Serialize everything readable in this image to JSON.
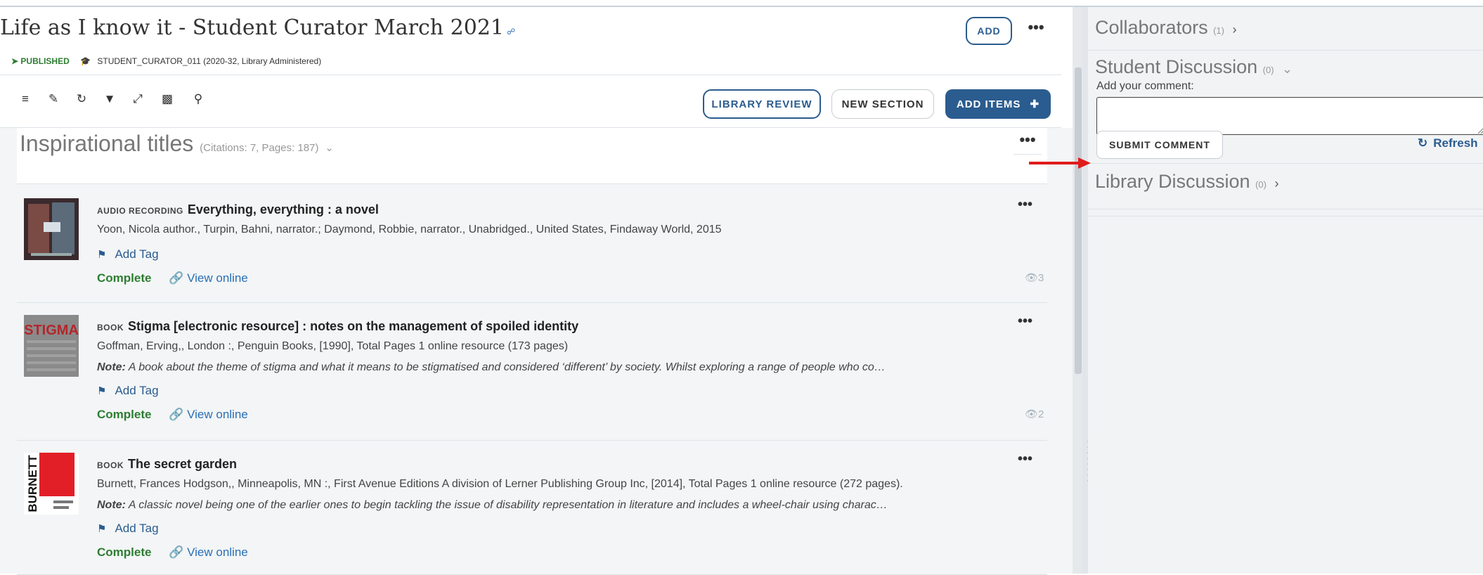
{
  "collection": {
    "title": "Life as I know it - Student Curator March 2021",
    "status": "PUBLISHED",
    "course": "STUDENT_CURATOR_011 (2020-32, Library Administered)",
    "add_label": "ADD"
  },
  "toolbar": {
    "library_review_label": "LIBRARY REVIEW",
    "new_section_label": "NEW SECTION",
    "add_items_label": "ADD ITEMS",
    "icons": [
      "list-icon",
      "edit-icon",
      "sync-icon",
      "filter-icon",
      "collapse-icon",
      "chart-icon",
      "search-icon"
    ]
  },
  "section": {
    "title": "Inspirational titles",
    "meta": "(Citations: 7, Pages: 187)"
  },
  "items": [
    {
      "kind": "AUDIO RECORDING",
      "title": "Everything, everything : a novel",
      "authors": "Yoon, Nicola author., Turpin, Bahni, narrator.; Daymond, Robbie, narrator., Unabridged., United States, Findaway World, 2015",
      "note_label": "",
      "note": "",
      "tag_label": "Add Tag",
      "status": "Complete",
      "view_label": "View online",
      "views": "3"
    },
    {
      "kind": "BOOK",
      "title": "Stigma [electronic resource] : notes on the management of spoiled identity",
      "authors": "Goffman, Erving,, London :, Penguin Books, [1990], Total Pages 1 online resource (173 pages)",
      "note_label": "Note:",
      "note": "A book about the theme of stigma and what it means to be stigmatised and considered ‘different’ by society. Whilst exploring a range of people who co…",
      "tag_label": "Add Tag",
      "status": "Complete",
      "view_label": "View online",
      "views": "2"
    },
    {
      "kind": "BOOK",
      "title": "The secret garden",
      "authors": "Burnett, Frances Hodgson,, Minneapolis, MN :, First Avenue Editions A division of Lerner Publishing Group Inc, [2014], Total Pages 1 online resource (272 pages).",
      "note_label": "Note:",
      "note": "A classic novel being one of the earlier ones to begin tackling the issue of disability representation in literature and includes a wheel-chair using charac…",
      "tag_label": "Add Tag",
      "status": "Complete",
      "view_label": "View online",
      "views": ""
    }
  ],
  "thumbs": {
    "stigma_cover_text": "STIGMA",
    "burnett_cover_text": "BURNETT"
  },
  "right_panel": {
    "collaborators": {
      "title": "Collaborators",
      "count": "(1)"
    },
    "student_discussion": {
      "title": "Student Discussion",
      "count": "(0)"
    },
    "comment_label": "Add your comment:",
    "comment_value": "",
    "submit_label": "SUBMIT COMMENT",
    "refresh_label": "Refresh",
    "library_discussion": {
      "title": "Library Discussion",
      "count": "(0)"
    }
  },
  "colors": {
    "primary": "#2b5c8f",
    "success": "#2e7d32",
    "annotation_arrow": "#e01b1b"
  }
}
